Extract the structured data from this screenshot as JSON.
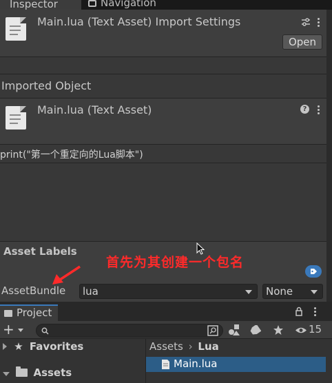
{
  "tabs": {
    "inspector": "Inspector",
    "navigation": "Navigation"
  },
  "import_header": {
    "title": "Main.lua (Text Asset) Import Settings",
    "open_button": "Open"
  },
  "imported_object": {
    "section_label": "Imported Object",
    "title": "Main.lua (Text Asset)"
  },
  "preview": {
    "code": "print(\"第一个重定向的Lua脚本\")"
  },
  "asset_labels": {
    "header": "Asset Labels",
    "assetbundle_label": "AssetBundle",
    "bundle_name": "lua",
    "variant": "None"
  },
  "annotation": {
    "text": "首先为其创建一个包名",
    "color": "#ff2a2a"
  },
  "project": {
    "tab_label": "Project",
    "hidden_count": "15",
    "favorites_label": "Favorites",
    "assets_label": "Assets",
    "breadcrumb": [
      "Assets",
      "Lua"
    ],
    "files": [
      "Main.lua"
    ]
  },
  "colors": {
    "accent": "#3a79bb",
    "selection": "#2c5d87",
    "background": "#383838",
    "tag_icon": "#3a79bb"
  }
}
